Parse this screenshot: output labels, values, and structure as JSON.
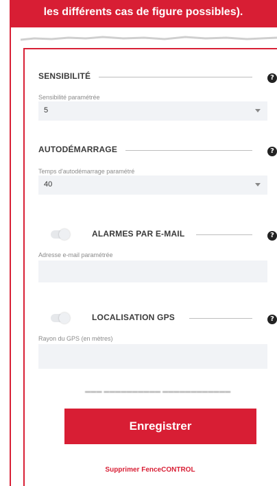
{
  "banner": {
    "text": "les différents cas de figure possibles)."
  },
  "sensitivity": {
    "title": "SENSIBILITÉ",
    "field_label": "Sensibilité paramétrée",
    "value": "5"
  },
  "autostart": {
    "title": "AUTODÉMARRAGE",
    "field_label": "Temps d'autodémarrage paramétré",
    "value": "40"
  },
  "email_alarms": {
    "title": "ALARMES PAR E-MAIL",
    "field_label": "Adresse e-mail paramétrée",
    "value": ""
  },
  "gps": {
    "title": "LOCALISATION GPS",
    "field_label": "Rayon du GPS (en mètres)",
    "value": ""
  },
  "actions": {
    "save_label": "Enregistrer",
    "delete_label": "Supprimer FenceCONTROL"
  },
  "colors": {
    "accent": "#d81e34",
    "field_bg": "#f1f3f6"
  },
  "icons": {
    "help": "question-mark-circle-icon",
    "dropdown": "caret-down-icon"
  }
}
